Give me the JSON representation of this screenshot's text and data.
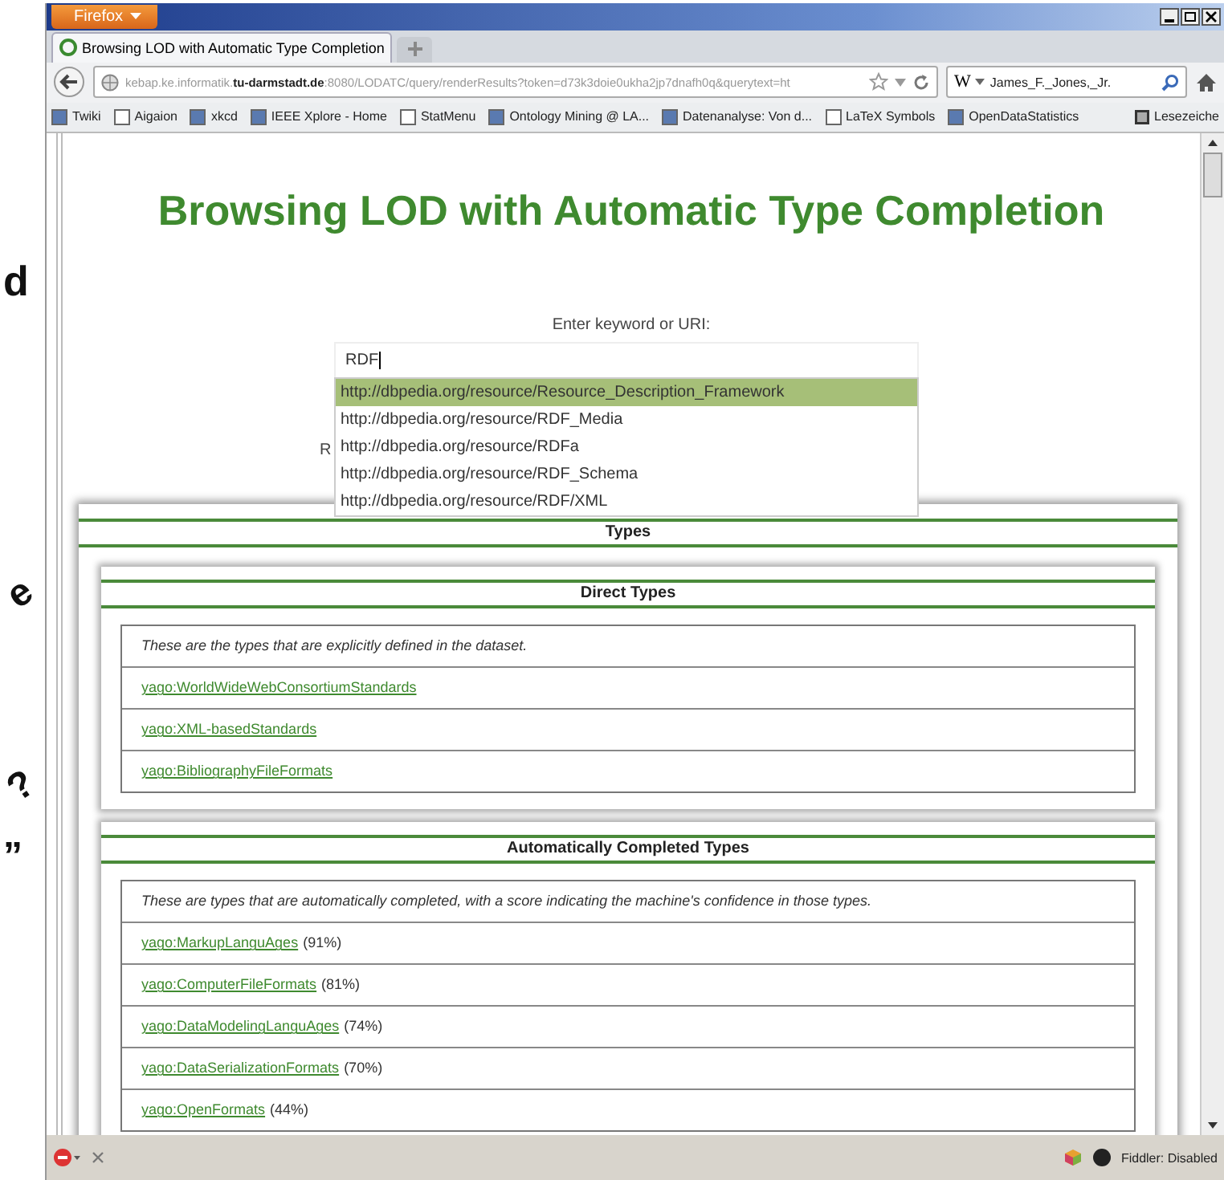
{
  "slide_fragments": [
    {
      "text": "d",
      "kind": "letter"
    },
    {
      "text": "e",
      "kind": "tilted"
    },
    {
      "text": "?",
      "kind": "tilted"
    },
    {
      "text": "”",
      "kind": "letter"
    }
  ],
  "browser": {
    "app_button": "Firefox",
    "tabs": [
      {
        "title": "Browsing LOD with Automatic Type Completion",
        "selected": true
      }
    ],
    "address": "kebap.ke.informatik.**tu-darmstadt.de**:8080/LODATC/query/renderResults?token=d73k3doie0ukha2jp7dnafh0q&querytext=ht",
    "search": {
      "engine": "W",
      "value": "James_F._Jones,_Jr."
    },
    "bookmarks": [
      "Twiki",
      "Aigaion",
      "xkcd",
      "IEEE Xplore - Home",
      "StatMenu",
      "Ontology Mining @ LA...",
      "Datenanalyse: Von d...",
      "LaTeX Symbols",
      "OpenDataStatistics"
    ],
    "bookmarks_menu": "Lesezeiche",
    "status": "Fiddler: Disabled"
  },
  "page": {
    "title": "Browsing LOD with Automatic Type Completion",
    "prompt": "Enter keyword or URI:",
    "query": "RDF",
    "covered_text": "R",
    "suggestions": [
      {
        "text": "http://dbpedia.org/resource/Resource_Description_Framework",
        "selected": true
      },
      {
        "text": "http://dbpedia.org/resource/RDF_Media",
        "selected": false
      },
      {
        "text": "http://dbpedia.org/resource/RDFa",
        "selected": false
      },
      {
        "text": "http://dbpedia.org/resource/RDF_Schema",
        "selected": false
      },
      {
        "text": "http://dbpedia.org/resource/RDF/XML",
        "selected": false
      }
    ],
    "panel_title": "Types",
    "groups": [
      {
        "title": "Direct Types",
        "note": "These are the types that are explicitly defined in the dataset.",
        "items": [
          {
            "link": "yago:WorldWideWebConsortiumStandards"
          },
          {
            "link": "yago:XML-basedStandards"
          },
          {
            "link": "yago:BibliographyFileFormats"
          }
        ]
      },
      {
        "title": "Automatically Completed Types",
        "note": "These are types that are automatically completed, with a score indicating the machine's confidence in those types.",
        "items": [
          {
            "link": "yago:MarkupLanguAges",
            "score": "(91%)"
          },
          {
            "link": "yago:ComputerFileFormats",
            "score": "(81%)"
          },
          {
            "link": "yago:DataModelingLanguAges",
            "score": "(74%)"
          },
          {
            "link": "yago:DataSerializationFormats",
            "score": "(70%)"
          },
          {
            "link": "yago:OpenFormats",
            "score": "(44%)"
          }
        ]
      }
    ]
  }
}
